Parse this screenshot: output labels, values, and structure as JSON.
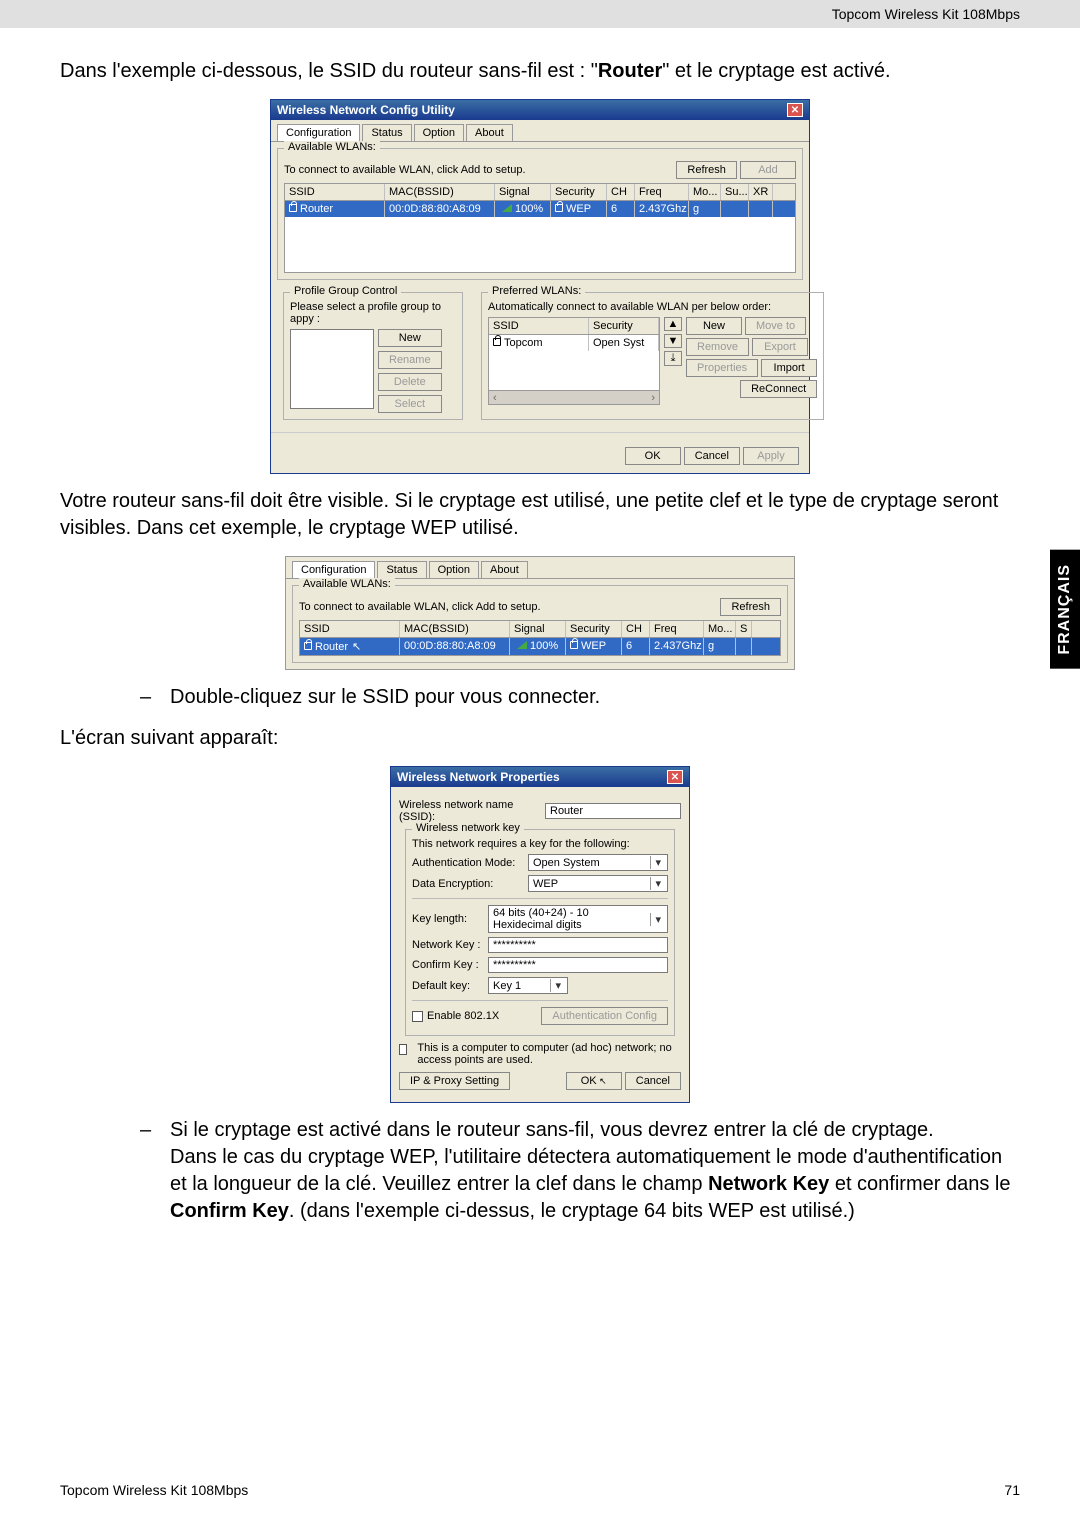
{
  "header": {
    "product": "Topcom Wireless Kit 108Mbps"
  },
  "sidebar_tab": "FRANÇAIS",
  "text": {
    "p1a": "Dans l'exemple ci-dessous, le SSID du routeur sans-fil est : \"",
    "p1b": "\" et le cryptage est activé.",
    "ssid_bold": "Router",
    "p2": "Votre routeur sans-fil doit être visible. Si le cryptage est utilisé, une petite clef et le type de cryptage seront visibles. Dans cet exemple, le cryptage WEP utilisé.",
    "li1": "Double-cliquez sur le SSID pour vous connecter.",
    "p3": "L'écran suivant apparaît:",
    "li2a": "Si le cryptage est activé dans le routeur sans-fil, vous devrez entrer la clé de cryptage.",
    "li2b1": "Dans le cas du cryptage WEP, l'utilitaire détectera automatiquement le mode d'authentification et la longueur de la clé. Veuillez entrer la clef dans le champ ",
    "li2b_bold1": "Network Key",
    "li2b2": " et confirmer dans le ",
    "li2b_bold2": "Confirm Key",
    "li2b3": ". (dans l'exemple ci-dessus, le cryptage 64 bits WEP est utilisé.)"
  },
  "dialog1": {
    "title": "Wireless Network Config Utility",
    "tabs": [
      "Configuration",
      "Status",
      "Option",
      "About"
    ],
    "available_legend": "Available WLANs:",
    "available_hint": "To connect to available WLAN, click Add to setup.",
    "refresh": "Refresh",
    "add": "Add",
    "cols": {
      "ssid": "SSID",
      "mac": "MAC(BSSID)",
      "signal": "Signal",
      "security": "Security",
      "ch": "CH",
      "freq": "Freq",
      "mo": "Mo...",
      "su": "Su...",
      "xr": "XR"
    },
    "row": {
      "ssid": "Router",
      "mac": "00:0D:88:80:A8:09",
      "signal": "100%",
      "security": "WEP",
      "ch": "6",
      "freq": "2.437Ghz",
      "mo": "g"
    },
    "profile_legend": "Profile Group Control",
    "profile_hint": "Please select a profile group to appy :",
    "btns": {
      "new": "New",
      "rename": "Rename",
      "delete": "Delete",
      "select": "Select"
    },
    "pref_legend": "Preferred WLANs:",
    "pref_hint": "Automatically connect to available WLAN per below order:",
    "pref_cols": {
      "ssid": "SSID",
      "security": "Security"
    },
    "pref_row": {
      "ssid": "Topcom",
      "security": "Open Syst"
    },
    "pref_btns": {
      "new": "New",
      "remove": "Remove",
      "properties": "Properties",
      "moveto": "Move to",
      "export": "Export",
      "import": "Import",
      "reconnect": "ReConnect"
    },
    "footer": {
      "ok": "OK",
      "cancel": "Cancel",
      "apply": "Apply"
    }
  },
  "dialog2": {
    "tabs": [
      "Configuration",
      "Status",
      "Option",
      "About"
    ],
    "available_legend": "Available WLANs:",
    "available_hint": "To connect to available WLAN, click Add to setup.",
    "refresh": "Refresh",
    "cols": {
      "ssid": "SSID",
      "mac": "MAC(BSSID)",
      "signal": "Signal",
      "security": "Security",
      "ch": "CH",
      "freq": "Freq",
      "mo": "Mo...",
      "s": "S"
    },
    "row": {
      "ssid": "Router",
      "mac": "00:0D:88:80:A8:09",
      "signal": "100%",
      "security": "WEP",
      "ch": "6",
      "freq": "2.437Ghz",
      "mo": "g"
    }
  },
  "dialog3": {
    "title": "Wireless Network Properties",
    "ssid_label": "Wireless network name (SSID):",
    "ssid_value": "Router",
    "key_legend": "Wireless network key",
    "key_hint": "This network requires a key for the following:",
    "auth_label": "Authentication Mode:",
    "auth_value": "Open System",
    "enc_label": "Data Encryption:",
    "enc_value": "WEP",
    "keylen_label": "Key length:",
    "keylen_value": "64 bits (40+24) - 10 Hexidecimal digits",
    "netkey_label": "Network Key :",
    "netkey_value": "**********",
    "confirm_label": "Confirm Key :",
    "confirm_value": "**********",
    "default_label": "Default key:",
    "default_value": "Key 1",
    "enable_8021x": "Enable 802.1X",
    "auth_config": "Authentication Config",
    "adhoc": "This is a computer to computer (ad hoc) network; no access points are used.",
    "ipproxy": "IP & Proxy Setting",
    "ok": "OK",
    "cancel": "Cancel"
  },
  "footer": {
    "product": "Topcom Wireless Kit 108Mbps",
    "page": "71"
  }
}
